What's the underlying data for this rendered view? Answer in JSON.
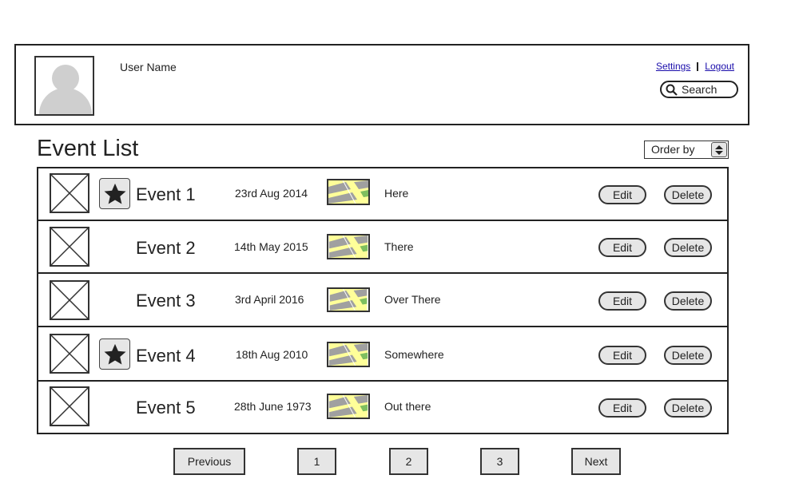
{
  "header": {
    "user_name": "User Name",
    "settings_link": "Settings",
    "logout_link": "Logout",
    "search_placeholder": "Search"
  },
  "main": {
    "title": "Event List",
    "order_by_label": "Order by"
  },
  "events": [
    {
      "name": "Event 1",
      "date": "23rd Aug 2014",
      "place": "Here",
      "starred": true,
      "edit_label": "Edit",
      "delete_label": "Delete"
    },
    {
      "name": "Event 2",
      "date": "14th May 2015",
      "place": "There",
      "starred": false,
      "edit_label": "Edit",
      "delete_label": "Delete"
    },
    {
      "name": "Event 3",
      "date": "3rd April 2016",
      "place": "Over There",
      "starred": false,
      "edit_label": "Edit",
      "delete_label": "Delete"
    },
    {
      "name": "Event 4",
      "date": "18th Aug 2010",
      "place": "Somewhere",
      "starred": true,
      "edit_label": "Edit",
      "delete_label": "Delete"
    },
    {
      "name": "Event 5",
      "date": "28th June 1973",
      "place": "Out there",
      "starred": false,
      "edit_label": "Edit",
      "delete_label": "Delete"
    }
  ],
  "pagination": {
    "previous_label": "Previous",
    "pages": [
      "1",
      "2",
      "3"
    ],
    "next_label": "Next"
  },
  "icons": {
    "avatar": "user-avatar-icon",
    "search": "magnifier-icon",
    "star": "star-icon",
    "image_placeholder": "image-placeholder-icon",
    "map": "map-thumbnail-icon",
    "order_spinner": "up-down-arrows-icon"
  },
  "colors": {
    "map_road": "#ffff99",
    "map_block": "#a0a0a0",
    "map_park": "#7fbf5f",
    "button_fill": "#e6e6e6",
    "link": "#1a0dab"
  }
}
